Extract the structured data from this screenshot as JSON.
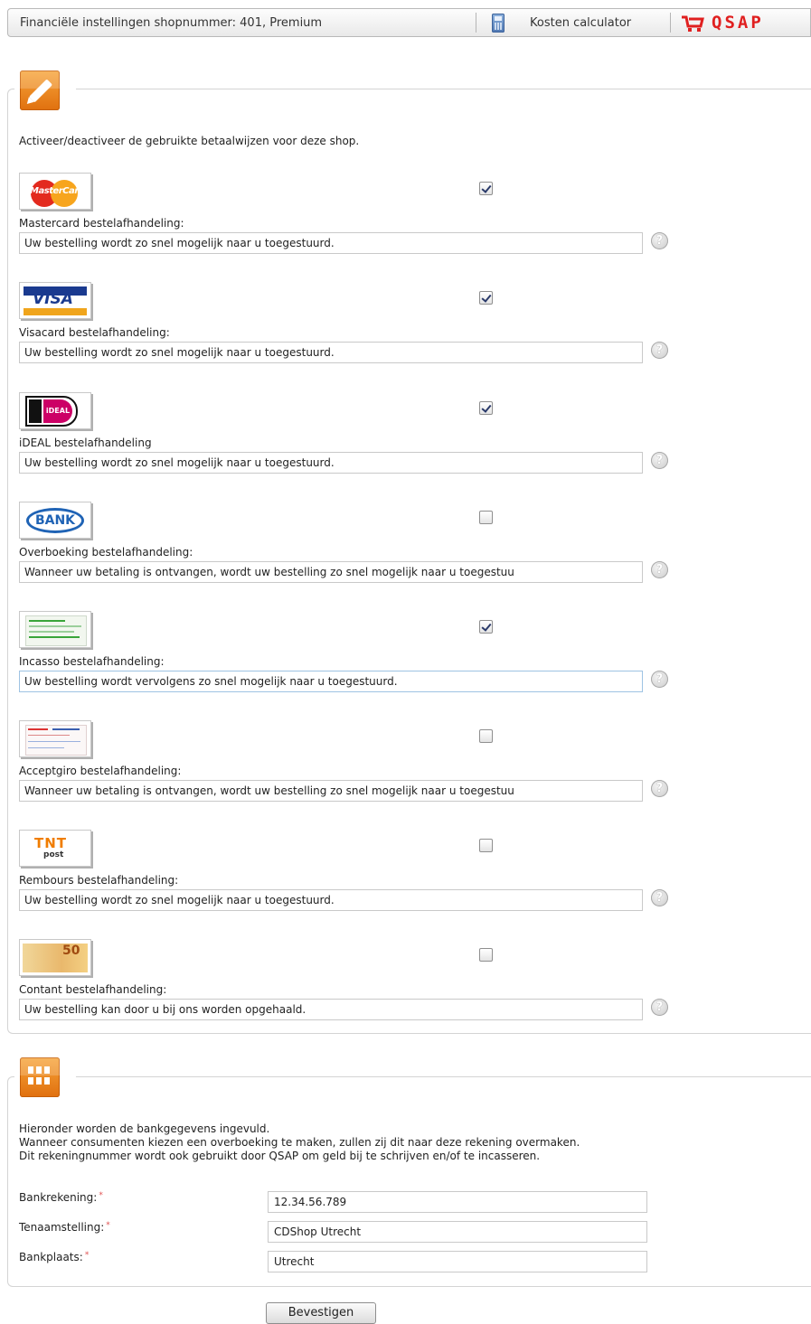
{
  "header": {
    "shop_title": "Financiële instellingen shopnummer: 401, Premium",
    "calculator_label": "Kosten calculator",
    "calculator_icon": "calculator-icon",
    "logo_text": "QSAP",
    "logo_icon": "shopping-cart-icon",
    "logo_color": "#e02020"
  },
  "payment_section": {
    "icon": "pencil-icon",
    "intro": "Activeer/deactiveer de gebruikte betaalwijzen voor deze shop.",
    "methods": [
      {
        "logo": "mastercard-logo",
        "logo_text": "MasterCard",
        "label": "Mastercard bestelafhandeling:",
        "enabled": true,
        "message": "Uw bestelling wordt zo snel mogelijk naar u toegestuurd."
      },
      {
        "logo": "visa-logo",
        "logo_text": "VISA",
        "label": "Visacard bestelafhandeling:",
        "enabled": true,
        "message": "Uw bestelling wordt zo snel mogelijk naar u toegestuurd."
      },
      {
        "logo": "ideal-logo",
        "logo_text": "iDEAL",
        "label": "iDEAL bestelafhandeling",
        "enabled": true,
        "message": "Uw bestelling wordt zo snel mogelijk naar u toegestuurd."
      },
      {
        "logo": "bank-logo",
        "logo_text": "BANK",
        "label": "Overboeking bestelafhandeling:",
        "enabled": false,
        "message": "Wanneer uw betaling is ontvangen, wordt uw bestelling zo snel mogelijk naar u toegestuu"
      },
      {
        "logo": "incasso-form-logo",
        "label": "Incasso bestelafhandeling:",
        "enabled": true,
        "message": "Uw bestelling wordt vervolgens zo snel mogelijk naar u toegestuurd."
      },
      {
        "logo": "acceptgiro-form-logo",
        "label": "Acceptgiro bestelafhandeling:",
        "enabled": false,
        "message": "Wanneer uw betaling is ontvangen, wordt uw bestelling zo snel mogelijk naar u toegestuu"
      },
      {
        "logo": "tnt-post-logo",
        "logo_text": "TNT",
        "logo_subtext": "post",
        "label": "Rembours bestelafhandeling:",
        "enabled": false,
        "message": "Uw bestelling wordt zo snel mogelijk naar u toegestuurd."
      },
      {
        "logo": "banknote-logo",
        "logo_text": "50",
        "label": "Contant bestelafhandeling:",
        "enabled": false,
        "message": "Uw bestelling kan door u bij ons worden opgehaald."
      }
    ],
    "help_icon": "help-icon",
    "help_glyph": "?"
  },
  "bank_section": {
    "icon": "grid-icon",
    "description": [
      "Hieronder worden de bankgegevens ingevuld.",
      "Wanneer consumenten kiezen een overboeking te maken, zullen zij dit naar deze rekening overmaken.",
      "Dit rekeningnummer wordt ook gebruikt door QSAP om geld bij te schrijven en/of te incasseren."
    ],
    "required_marker": "*",
    "fields": [
      {
        "label": "Bankrekening:",
        "value": "12.34.56.789"
      },
      {
        "label": "Tenaamstelling:",
        "value": "CDShop Utrecht"
      },
      {
        "label": "Bankplaats:",
        "value": "Utrecht"
      }
    ]
  },
  "confirm_label": "Bevestigen"
}
